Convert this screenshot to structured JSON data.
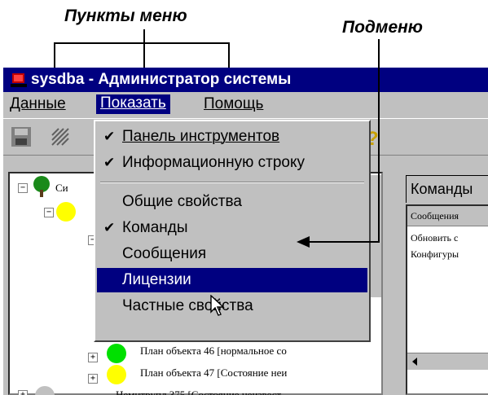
{
  "annotations": {
    "menu_items_label": "Пункты меню",
    "submenu_label": "Подменю"
  },
  "window": {
    "title": "sysdba - Администратор системы",
    "title_color": "#000080"
  },
  "menubar": {
    "items": [
      {
        "label": "Данные"
      },
      {
        "label": "Показать"
      },
      {
        "label": "Помощь"
      }
    ]
  },
  "dropdown": {
    "items": [
      {
        "label": "Панель инструментов",
        "checked": true,
        "check_glyph": "✔"
      },
      {
        "label": "Информационную строку",
        "checked": true,
        "check_glyph": "✔"
      },
      {
        "label": "Общие свойства",
        "checked": false
      },
      {
        "label": "Команды",
        "checked": true,
        "check_glyph": "✔"
      },
      {
        "label": "Сообщения",
        "checked": false
      },
      {
        "label": "Лицензии",
        "checked": false,
        "selected": true
      },
      {
        "label": "Частные свойства",
        "checked": false
      }
    ]
  },
  "tree": {
    "root_label": "Си",
    "rows": [
      {
        "label": "План объекта 46 [нормальное со"
      },
      {
        "label": "План объекта 47 [Состояние неи"
      },
      {
        "label": "Немнтрупл 375 [Состояние неизвест"
      }
    ]
  },
  "right_panel": {
    "tab_label": "Команды",
    "column_header": "Сообщения",
    "rows": [
      "Обновить с",
      "Конфигуры"
    ]
  }
}
